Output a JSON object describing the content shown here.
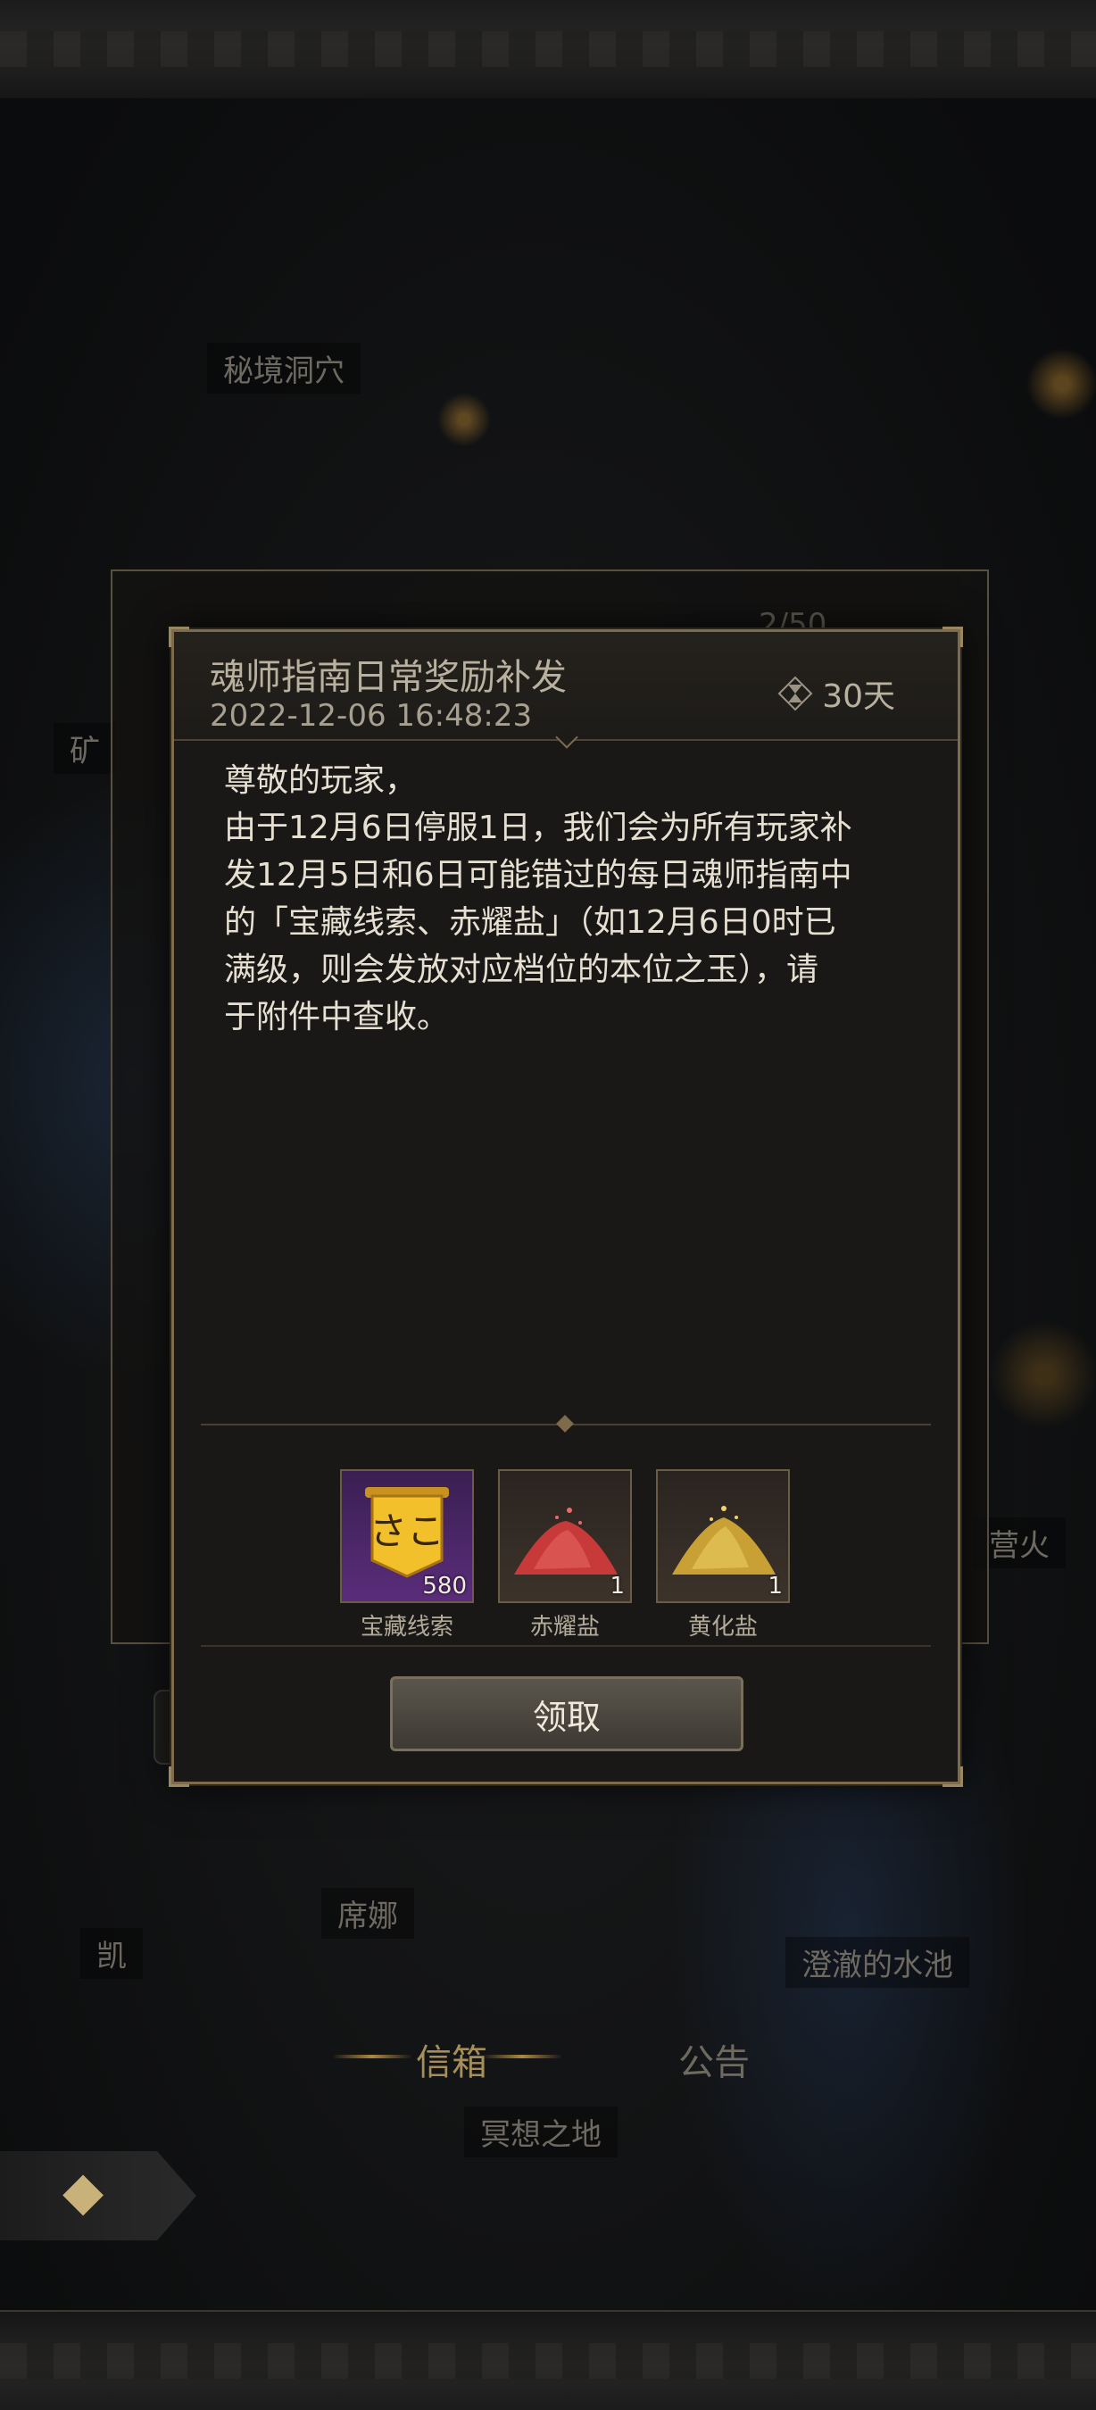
{
  "background": {
    "map_labels": {
      "secret_cave": "秘境洞穴",
      "mine": "矿",
      "campfire": "营火",
      "kai": "凯",
      "xina": "席娜",
      "clear_pool": "澄澈的水池",
      "meditation_land": "冥想之地"
    },
    "panel_counter": "2/50"
  },
  "tabs": {
    "mailbox": "信箱",
    "announcement": "公告"
  },
  "mail": {
    "title": "魂师指南日常奖励补发",
    "datetime": "2022-12-06 16:48:23",
    "expire": "30天",
    "body": {
      "greeting": "尊敬的玩家，",
      "line1": "由于12月6日停服1日，我们会为所有玩家补",
      "line2": "发12月5日和6日可能错过的每日魂师指南中",
      "line3": "的「宝藏线索、赤耀盐」（如12月6日0时已",
      "line4": "满级，则会发放对应档位的本位之玉），请",
      "line5": "于附件中查收。"
    },
    "attachments": [
      {
        "name": "宝藏线索",
        "count": "580",
        "icon": "treasure-clue-scroll-icon"
      },
      {
        "name": "赤耀盐",
        "count": "1",
        "icon": "red-salt-pile-icon"
      },
      {
        "name": "黄化盐",
        "count": "1",
        "icon": "yellow-salt-pile-icon"
      }
    ],
    "claim_label": "领取"
  },
  "colors": {
    "accent_gold": "#7d6b4c",
    "treasure_bg": "#5a2d7a",
    "red_salt": "#c83a3a",
    "yellow_salt": "#c9a034"
  }
}
